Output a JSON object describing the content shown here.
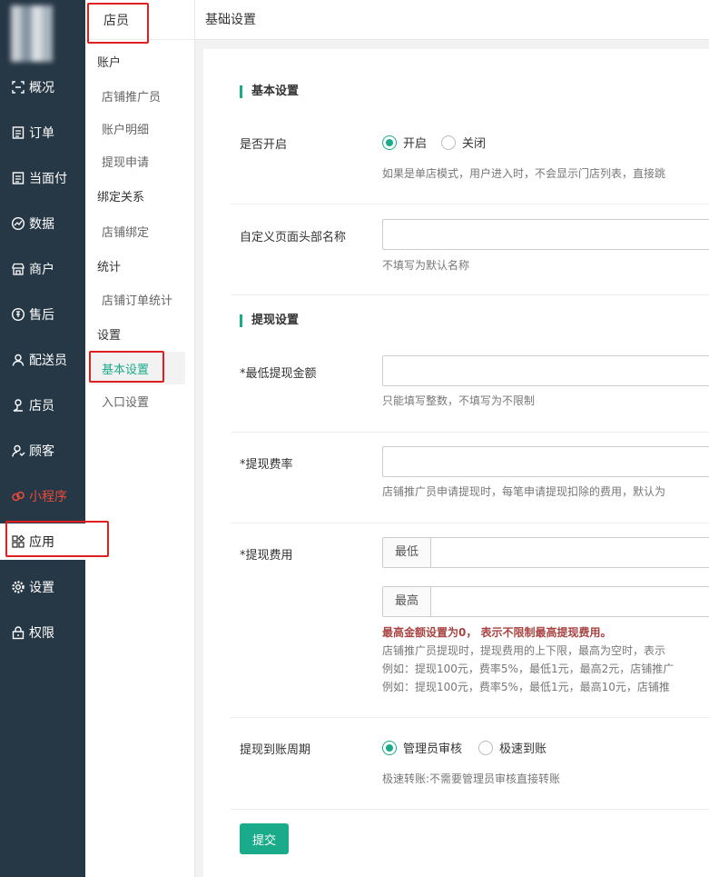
{
  "nav": {
    "items": [
      {
        "label": "概况",
        "icon": "overview-icon"
      },
      {
        "label": "订单",
        "icon": "order-icon"
      },
      {
        "label": "当面付",
        "icon": "pay-icon"
      },
      {
        "label": "数据",
        "icon": "chart-icon"
      },
      {
        "label": "商户",
        "icon": "store-icon"
      },
      {
        "label": "售后",
        "icon": "aftersale-icon"
      },
      {
        "label": "配送员",
        "icon": "courier-icon"
      },
      {
        "label": "店员",
        "icon": "clerk-icon"
      },
      {
        "label": "顾客",
        "icon": "customer-icon"
      },
      {
        "label": "小程序",
        "icon": "miniprogram-icon"
      },
      {
        "label": "应用",
        "icon": "apps-icon"
      },
      {
        "label": "设置",
        "icon": "gear-icon"
      },
      {
        "label": "权限",
        "icon": "lock-icon"
      }
    ],
    "accent_red": "#e74c3c"
  },
  "submenu": {
    "title": "店员",
    "groups": {
      "account": "账户",
      "bind": "绑定关系",
      "stats": "统计",
      "settings": "设置"
    },
    "links": {
      "promoter": "店铺推广员",
      "account_detail": "账户明细",
      "withdraw_apply": "提现申请",
      "store_bind": "店铺绑定",
      "order_stats": "店铺订单统计",
      "basic_settings": "基本设置",
      "entry_settings": "入口设置"
    }
  },
  "topbar": {
    "title": "基础设置"
  },
  "form": {
    "basic": {
      "title": "基本设置",
      "enable_label": "是否开启",
      "enable_on": "开启",
      "enable_off": "关闭",
      "enable_hint": "如果是单店模式，用户进入时，不会显示门店列表，直接跳",
      "header_name_label": "自定义页面头部名称",
      "header_name_hint": "不填写为默认名称"
    },
    "withdraw": {
      "title": "提现设置",
      "min_label": "*最低提现金额",
      "min_hint": "只能填写整数，不填写为不限制",
      "rate_label": "*提现费率",
      "rate_hint": "店铺推广员申请提现时，每笔申请提现扣除的费用，默认为",
      "fee_label": "*提现费用",
      "fee_min": "最低",
      "fee_max": "最高",
      "fee_warn": "最高金额设置为0， 表示不限制最高提现费用。",
      "fee_hint1": "店铺推广员提现时，提现费用的上下限，最高为空时，表示",
      "fee_hint2": "例如：提现100元，费率5%，最低1元，最高2元，店铺推广",
      "fee_hint3": "例如：提现100元，费率5%，最低1元，最高10元，店铺推",
      "period_label": "提现到账周期",
      "period_admin": "管理员审核",
      "period_fast": "极速到账",
      "period_hint": "极速转账:不需要管理员审核直接转账"
    },
    "submit": "提交"
  },
  "colors": {
    "primary": "#1aab8a",
    "nav_bg": "#263745",
    "highlight_box": "#e02020"
  }
}
